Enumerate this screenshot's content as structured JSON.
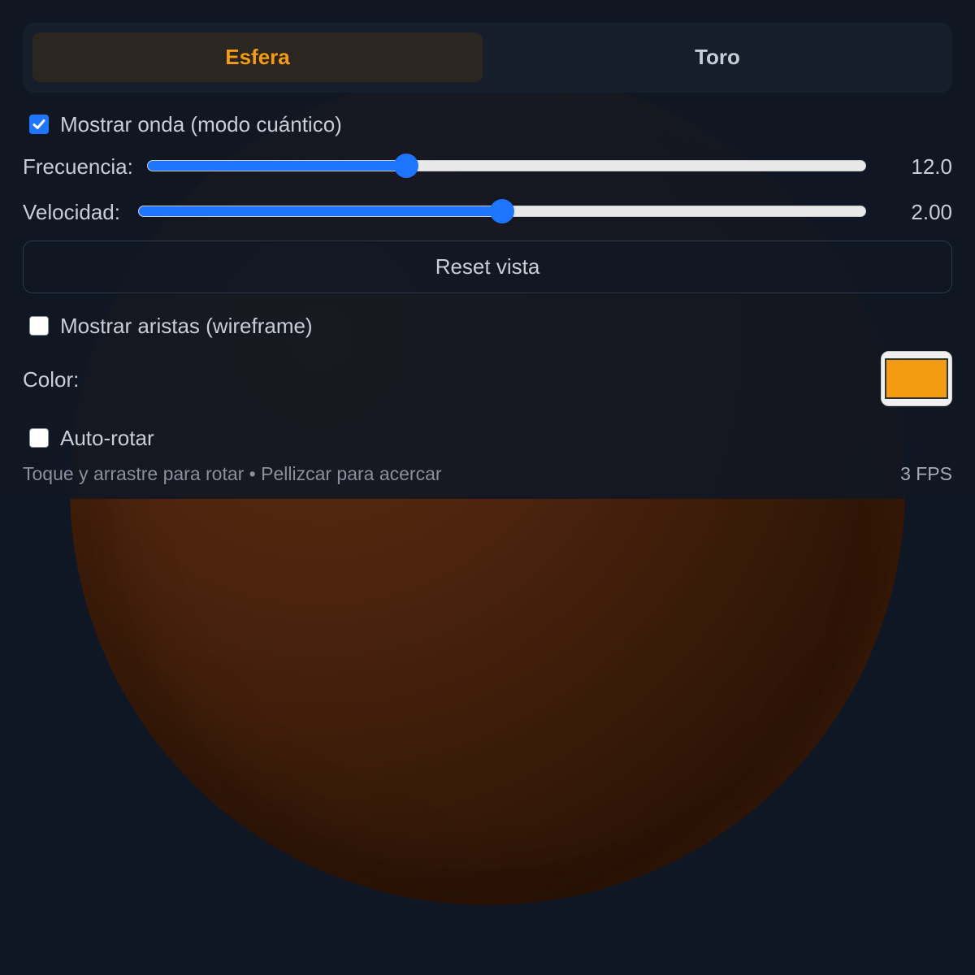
{
  "tabs": [
    {
      "label": "Esfera",
      "active": true
    },
    {
      "label": "Toro",
      "active": false
    }
  ],
  "controls": {
    "show_wave": {
      "label": "Mostrar onda (modo cuántico)",
      "checked": true
    },
    "frequency": {
      "label": "Frecuencia:",
      "value_text": "12.0",
      "fill_fraction": 0.36
    },
    "speed": {
      "label": "Velocidad:",
      "value_text": "2.00",
      "fill_fraction": 0.5
    },
    "reset_label": "Reset vista",
    "show_edges": {
      "label": "Mostrar aristas (wireframe)",
      "checked": false
    },
    "color": {
      "label": "Color:",
      "value": "#f39c12"
    },
    "auto_rotate": {
      "label": "Auto-rotar",
      "checked": false
    }
  },
  "hint": "Toque y arrastre para rotar • Pellizcar para acercar",
  "fps": "3 FPS",
  "colors": {
    "accent": "#f39c12",
    "slider_blue": "#1e76ff",
    "background": "#0f1724",
    "sphere_base": "#4d240e"
  }
}
